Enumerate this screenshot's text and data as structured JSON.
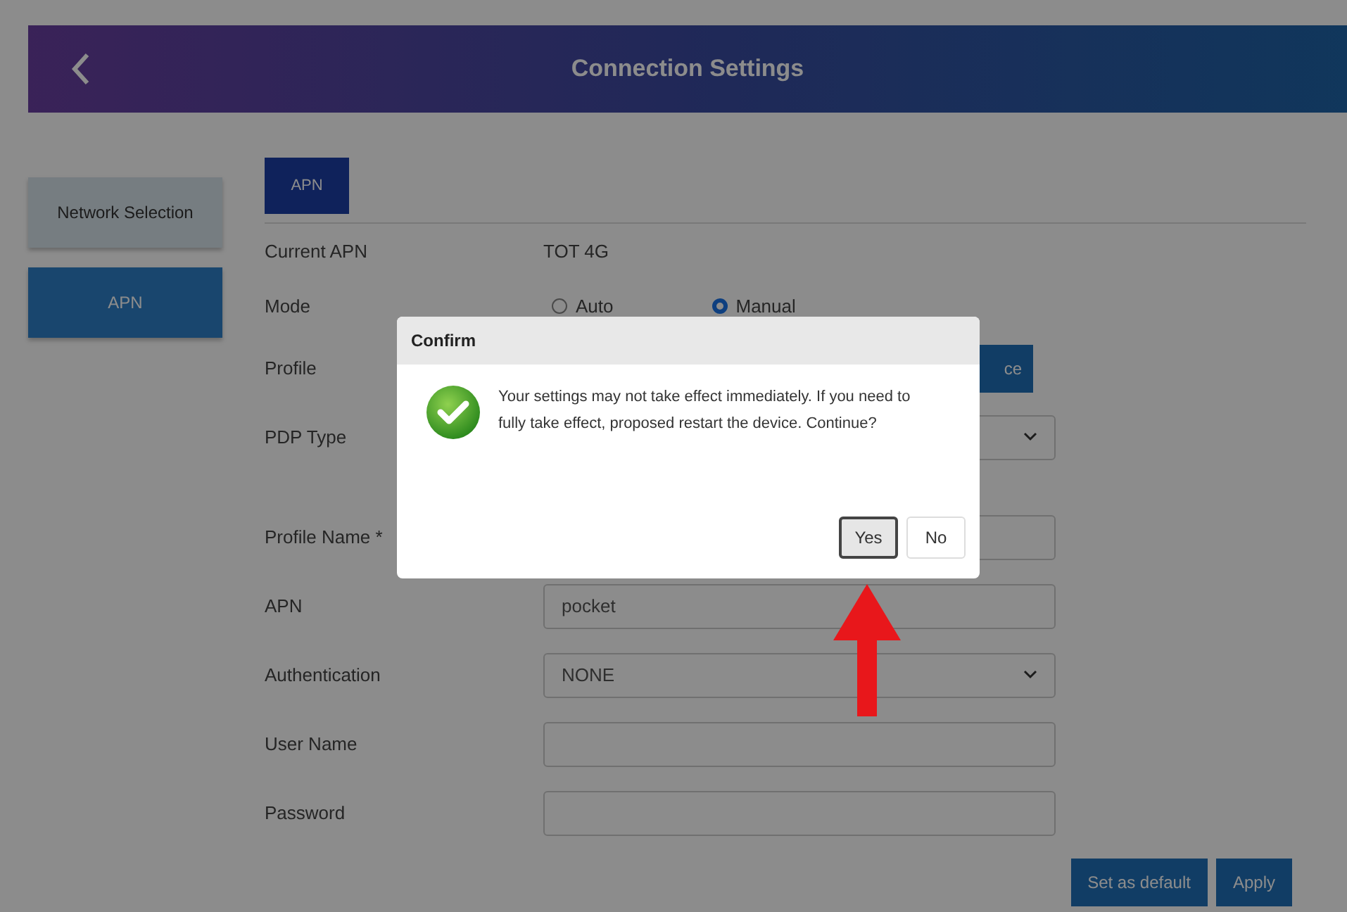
{
  "header": {
    "title": "Connection Settings"
  },
  "sidebar": {
    "items": [
      {
        "label": "Network Selection",
        "selected": false
      },
      {
        "label": "APN",
        "selected": true
      }
    ]
  },
  "tab": {
    "label": "APN",
    "selected": true
  },
  "current_apn": {
    "label": "Current APN",
    "value": "TOT 4G"
  },
  "mode": {
    "label": "Mode",
    "options": [
      {
        "label": "Auto",
        "selected": false
      },
      {
        "label": "Manual",
        "selected": true
      }
    ]
  },
  "profile": {
    "label": "Profile",
    "button": "ce"
  },
  "form": [
    {
      "kind": "select",
      "label": "PDP Type"
    },
    {
      "kind": "input",
      "label": "Profile Name *"
    },
    {
      "kind": "input",
      "label": "APN",
      "value": "pocket"
    },
    {
      "kind": "select",
      "label": "Authentication",
      "value": "NONE"
    },
    {
      "kind": "input",
      "label": "User Name"
    },
    {
      "kind": "input",
      "label": "Password"
    }
  ],
  "buttons": [
    "Set as default",
    "Apply"
  ],
  "dialog": {
    "title": "Confirm",
    "message": "Your settings may not take effect immediately. If you need to fully take effect, proposed restart the device. Continue?",
    "buttons": [
      {
        "label": "Yes",
        "selected": true
      },
      {
        "label": "No",
        "selected": false
      }
    ]
  }
}
